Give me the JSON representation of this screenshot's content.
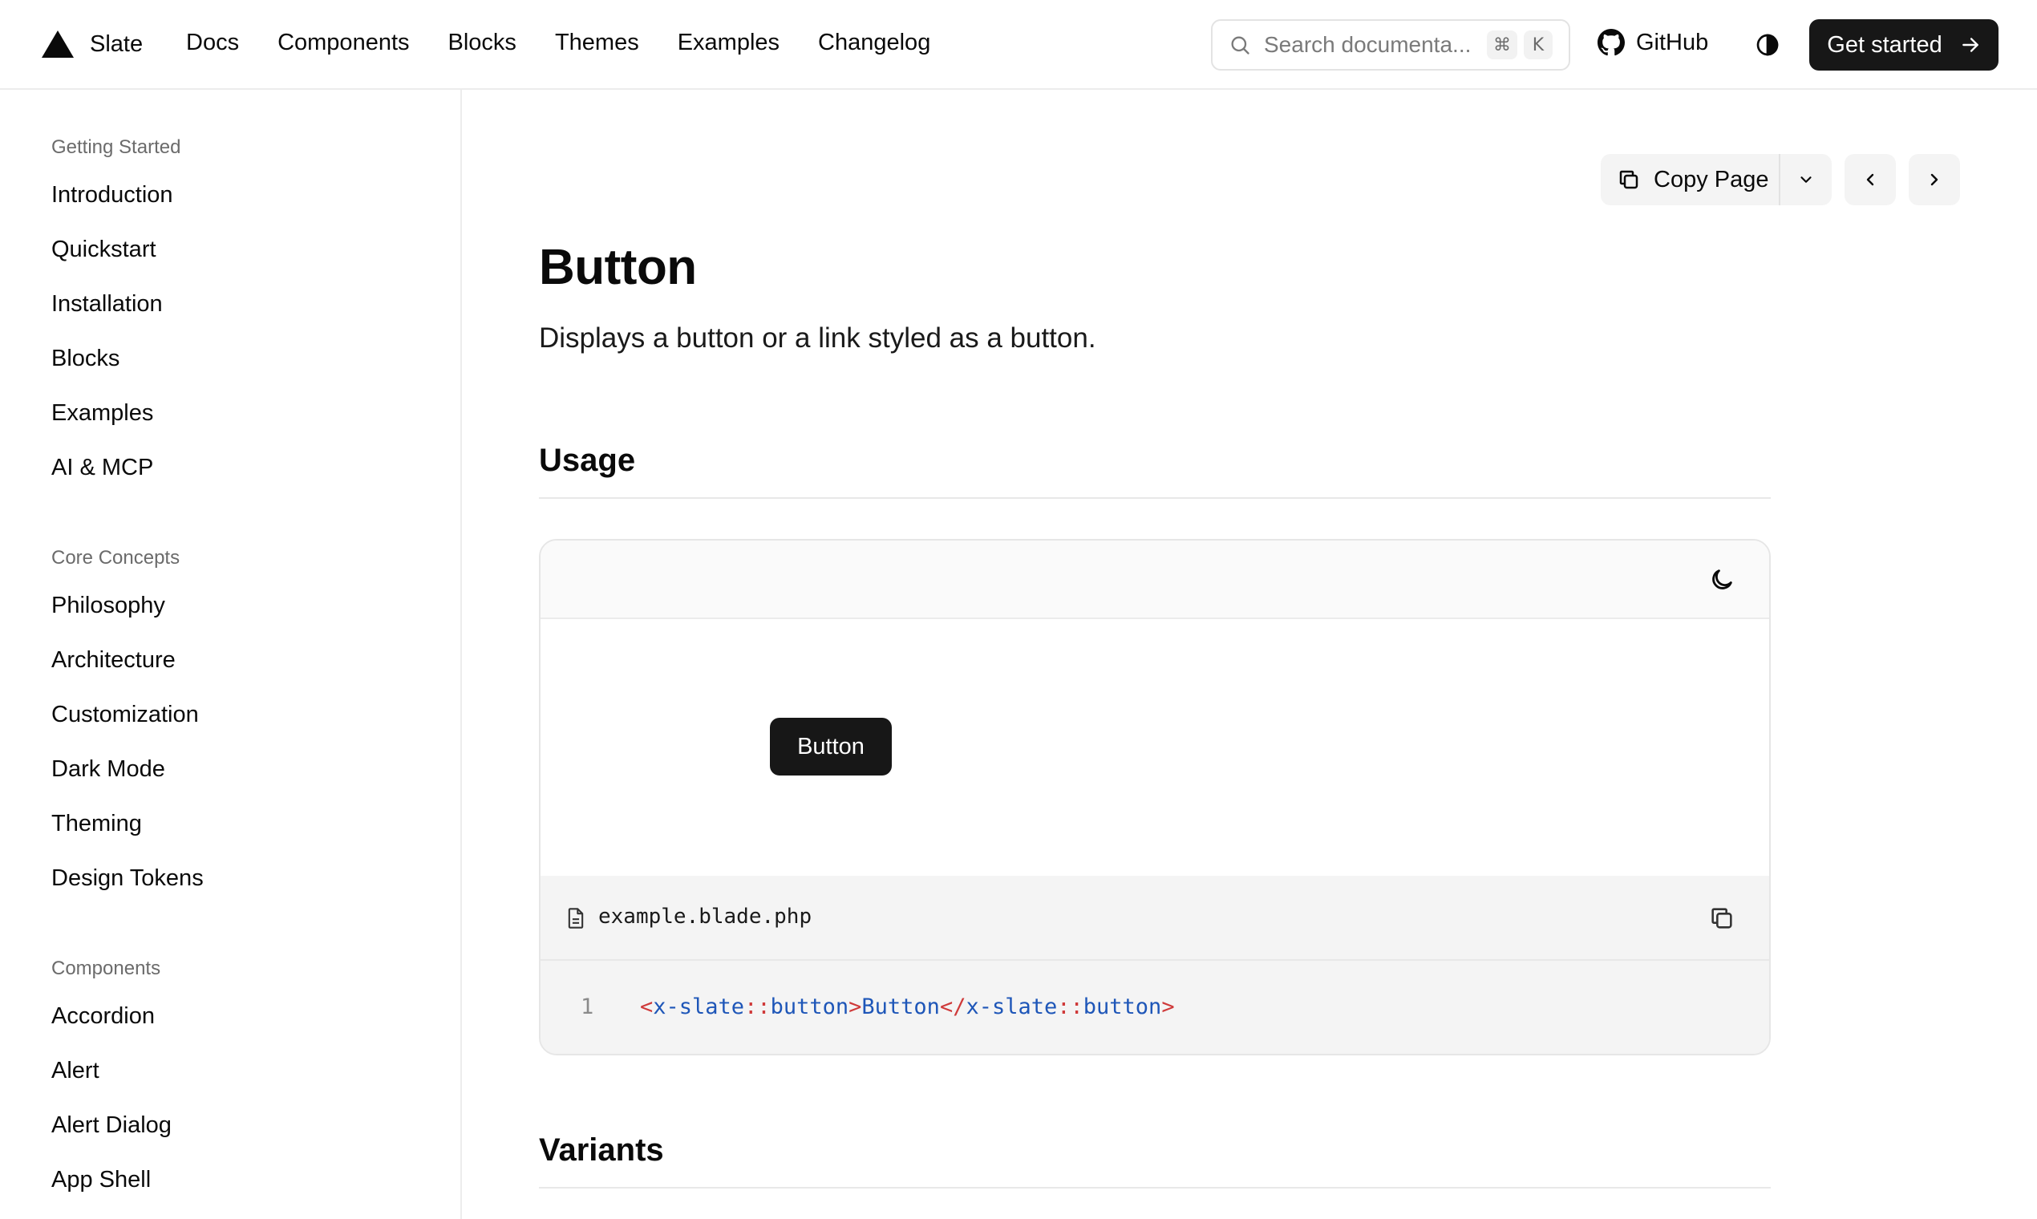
{
  "header": {
    "brand": "Slate",
    "nav": [
      "Docs",
      "Components",
      "Blocks",
      "Themes",
      "Examples",
      "Changelog"
    ],
    "search": {
      "placeholder": "Search documenta...",
      "shortcut": [
        "⌘",
        "K"
      ]
    },
    "github_label": "GitHub",
    "cta_label": "Get started"
  },
  "sidebar": {
    "groups": [
      {
        "title": "Getting Started",
        "items": [
          "Introduction",
          "Quickstart",
          "Installation",
          "Blocks",
          "Examples",
          "AI & MCP"
        ]
      },
      {
        "title": "Core Concepts",
        "items": [
          "Philosophy",
          "Architecture",
          "Customization",
          "Dark Mode",
          "Theming",
          "Design Tokens"
        ]
      },
      {
        "title": "Components",
        "items": [
          "Accordion",
          "Alert",
          "Alert Dialog",
          "App Shell"
        ]
      }
    ]
  },
  "page": {
    "copy_label": "Copy Page",
    "title": "Button",
    "description": "Displays a button or a link styled as a button.",
    "sections": [
      "Usage",
      "Variants"
    ]
  },
  "demo": {
    "button_label": "Button",
    "filename": "example.blade.php",
    "line_number": "1",
    "code_tokens": [
      "<",
      "x-slate",
      "::",
      "button",
      ">",
      "Button",
      "</",
      "x-slate",
      "::",
      "button",
      ">"
    ]
  },
  "colors": {
    "primary": "#171717",
    "border": "#ececec",
    "muted_text": "#6b6b6b",
    "code_punct": "#cf3a3a",
    "code_tag": "#1e56b8"
  }
}
